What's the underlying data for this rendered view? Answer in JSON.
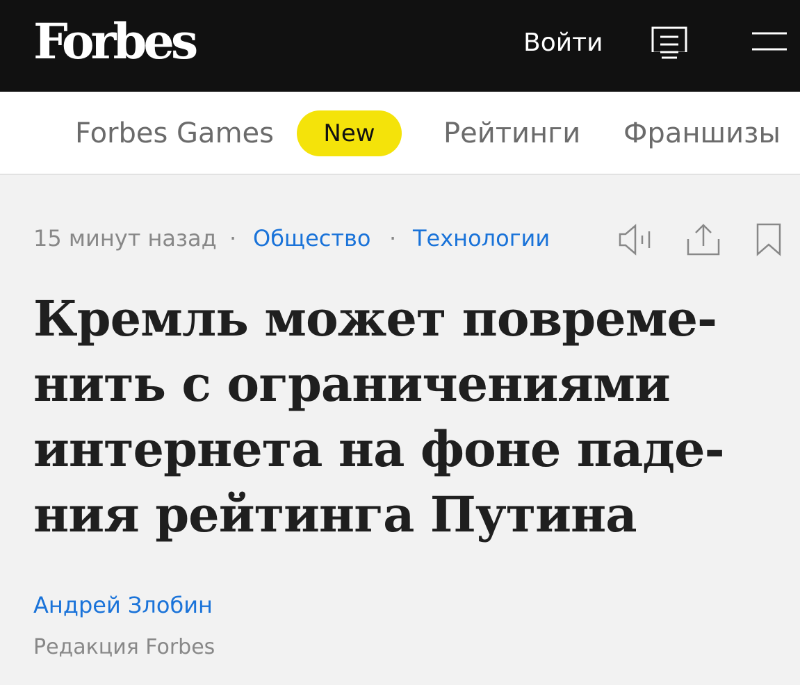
{
  "header": {
    "logo_text": "Forbes",
    "login_label": "Войти",
    "feed_icon": "feed-icon",
    "menu_icon": "menu-icon",
    "background": "#111111"
  },
  "nav": {
    "items": [
      {
        "label": "Forbes Games"
      },
      {
        "label": "New",
        "badge": true,
        "color": "#f4e30a"
      },
      {
        "label": "Рейтинги"
      },
      {
        "label": "Франшизы"
      }
    ]
  },
  "article": {
    "meta": {
      "time": "15 минут назад",
      "separator": "·",
      "categories": [
        "Общество",
        "Технологии"
      ]
    },
    "actions": [
      "audio-icon",
      "share-icon",
      "bookmark-icon"
    ],
    "headline_lines": [
      "Кремль может повреме-",
      "нить с ограничениями",
      "интернета на фоне паде-",
      "ния рейтинга Путина"
    ],
    "author": {
      "name": "Андрей Злобин",
      "role": "Редакция Forbes"
    },
    "link_color": "#1a73d9"
  }
}
